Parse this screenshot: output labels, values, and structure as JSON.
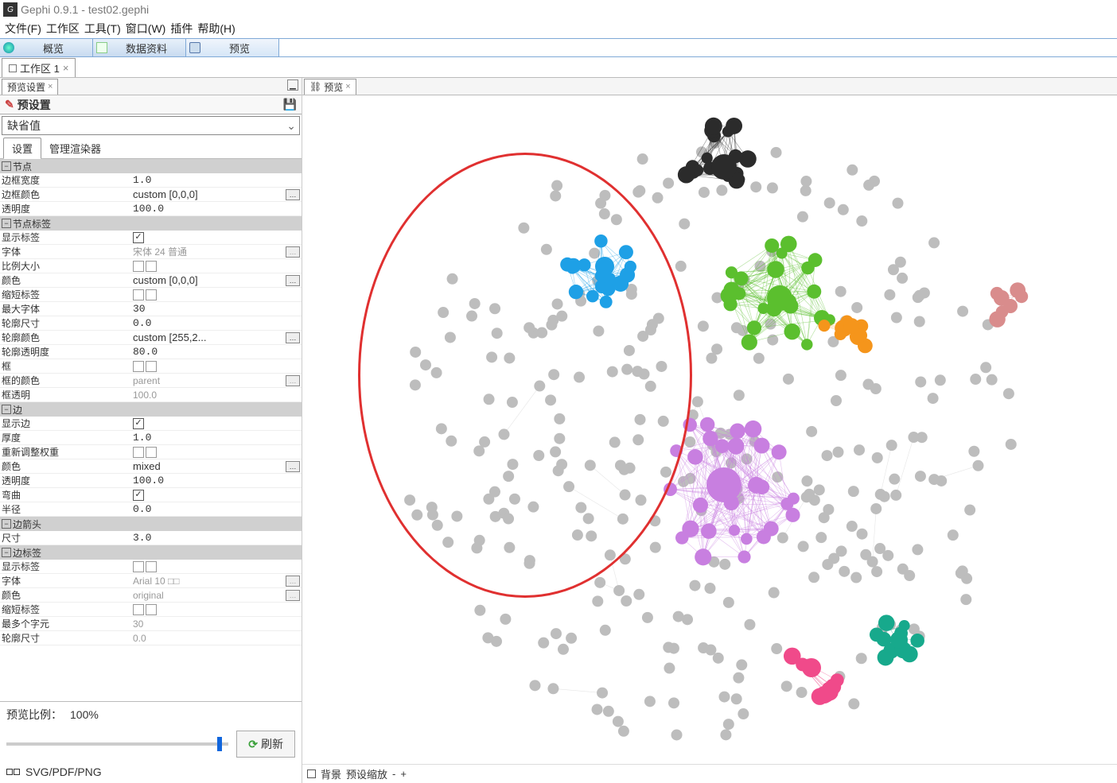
{
  "app": {
    "title": "Gephi 0.9.1 - test02.gephi"
  },
  "menu": {
    "file": "文件(F)",
    "workspace": "工作区",
    "tools": "工具(T)",
    "window": "窗口(W)",
    "plugins": "插件",
    "help": "帮助(H)"
  },
  "perspectives": {
    "overview": "概览",
    "datalab": "数据资料",
    "preview": "预览"
  },
  "workspace_tab": "工作区 1",
  "left": {
    "panel_tab": "预览设置",
    "presets_header": "预设置",
    "preset_value": "缺省值",
    "subtabs": {
      "settings": "设置",
      "renderers": "管理渲染器"
    },
    "sections": {
      "node": {
        "title": "节点",
        "rows": {
          "border_width": {
            "label": "边框宽度",
            "value": "1.0"
          },
          "border_color": {
            "label": "边框颜色",
            "value": "custom [0,0,0]"
          },
          "opacity": {
            "label": "透明度",
            "value": "100.0"
          }
        }
      },
      "node_label": {
        "title": "节点标签",
        "rows": {
          "show": {
            "label": "显示标签",
            "checked": true
          },
          "font": {
            "label": "字体",
            "value": "宋体 24 普通"
          },
          "proportional": {
            "label": "比例大小"
          },
          "color": {
            "label": "颜色",
            "value": "custom [0,0,0]"
          },
          "shorten": {
            "label": "缩短标签"
          },
          "max_font": {
            "label": "最大字体",
            "value": "30"
          },
          "outline_size": {
            "label": "轮廓尺寸",
            "value": "0.0"
          },
          "outline_color": {
            "label": "轮廓颜色",
            "value": "custom [255,2..."
          },
          "outline_opacity": {
            "label": "轮廓透明度",
            "value": "80.0"
          },
          "box": {
            "label": "框"
          },
          "box_color": {
            "label": "框的颜色",
            "value": "parent"
          },
          "box_opacity": {
            "label": "框透明",
            "value": "100.0"
          }
        }
      },
      "edge": {
        "title": "边",
        "rows": {
          "show": {
            "label": "显示边",
            "checked": true
          },
          "thickness": {
            "label": "厚度",
            "value": "1.0"
          },
          "rescale": {
            "label": "重新调整权重"
          },
          "color": {
            "label": "颜色",
            "value": "mixed"
          },
          "opacity": {
            "label": "透明度",
            "value": "100.0"
          },
          "curved": {
            "label": "弯曲",
            "checked": true
          },
          "radius": {
            "label": "半径",
            "value": "0.0"
          }
        }
      },
      "edge_arrow": {
        "title": "边箭头",
        "rows": {
          "size": {
            "label": "尺寸",
            "value": "3.0"
          }
        }
      },
      "edge_label": {
        "title": "边标签",
        "rows": {
          "show": {
            "label": "显示标签"
          },
          "font": {
            "label": "字体",
            "value": "Arial 10 □□"
          },
          "color": {
            "label": "颜色",
            "value": "original"
          },
          "shorten": {
            "label": "缩短标签"
          },
          "max_chars": {
            "label": "最多个字元",
            "value": "30"
          },
          "outline_size": {
            "label": "轮廓尺寸",
            "value": "0.0"
          }
        }
      }
    },
    "preview_ratio_label": "预览比例：",
    "preview_ratio_value": "100%",
    "refresh": "刷新",
    "export": "SVG/PDF/PNG"
  },
  "right": {
    "panel_tab": "预览",
    "bottom": {
      "background": "背景",
      "reset_zoom": "预设缩放",
      "minus": "-",
      "plus": "+"
    }
  }
}
